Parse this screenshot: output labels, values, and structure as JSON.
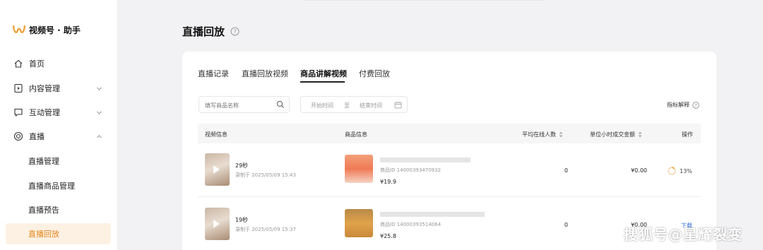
{
  "app": {
    "title": "视频号 · 助手",
    "accent_color": "#e3861a",
    "logo_color": "#f0a23a"
  },
  "sidebar": {
    "items": [
      {
        "label": "首页",
        "icon": "home-icon"
      },
      {
        "label": "内容管理",
        "icon": "content-icon",
        "expandable": true
      },
      {
        "label": "互动管理",
        "icon": "chat-icon",
        "expandable": true
      },
      {
        "label": "直播",
        "icon": "live-icon",
        "expandable": true,
        "expanded": true
      }
    ],
    "live_sub_items": [
      {
        "label": "直播管理"
      },
      {
        "label": "直播商品管理"
      },
      {
        "label": "直播预告"
      },
      {
        "label": "直播回放",
        "active": true
      }
    ]
  },
  "header": {
    "title": "直播回放",
    "help_icon": "help-circle-icon"
  },
  "tabs": [
    {
      "label": "直播记录"
    },
    {
      "label": "直播回放视频"
    },
    {
      "label": "商品讲解视频",
      "active": true
    },
    {
      "label": "付费回放"
    }
  ],
  "filters": {
    "search_placeholder": "填写商品名称",
    "start_placeholder": "开始时间",
    "separator": "至",
    "end_placeholder": "结束时间",
    "metric_explain": "指标解释"
  },
  "table": {
    "columns": [
      "视频信息",
      "商品信息",
      "平均在线人数",
      "单位小时成交金额",
      "操作"
    ],
    "rows": [
      {
        "duration": "29秒",
        "recorded": "录制于 2025/05/09 15:43",
        "product_id": "商品ID 14000393470932",
        "price": "¥19.9",
        "avg_online": "0",
        "hourly_amount": "¥0.00",
        "operation": "13%",
        "progress": 0.13
      },
      {
        "duration": "19秒",
        "recorded": "录制于 2025/05/09 15:37",
        "product_id": "商品ID 14000393514064",
        "price": "¥25.8",
        "avg_online": "0",
        "hourly_amount": "¥0.00",
        "operation": "下载"
      }
    ]
  },
  "watermark": "搜狐号@星耀裂变"
}
